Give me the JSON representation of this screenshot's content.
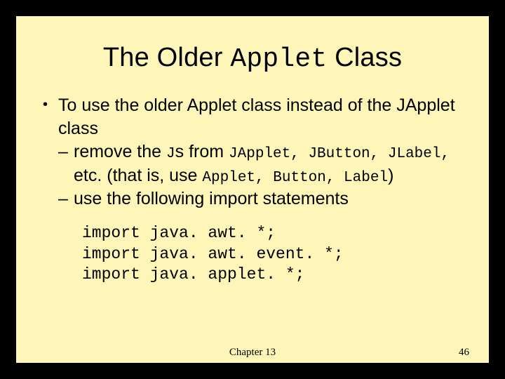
{
  "title": {
    "pre": "The Older ",
    "code": "Applet",
    "post": " Class"
  },
  "lead": "To use the older Applet class instead of the JApplet class",
  "sub1": {
    "a": "remove the ",
    "J": "J",
    "b": "s from ",
    "list1": "JApplet, JButton, JLabel,",
    "c": "etc. (that is, use ",
    "list2": "Applet, Button, Label",
    "d": ")"
  },
  "sub2": "use the following import statements",
  "imports": {
    "l1": "import java. awt. *;",
    "l2": "import java. awt. event. *;",
    "l3": "import java. applet. *;"
  },
  "footer": {
    "chapter": "Chapter 13",
    "page": "46"
  }
}
